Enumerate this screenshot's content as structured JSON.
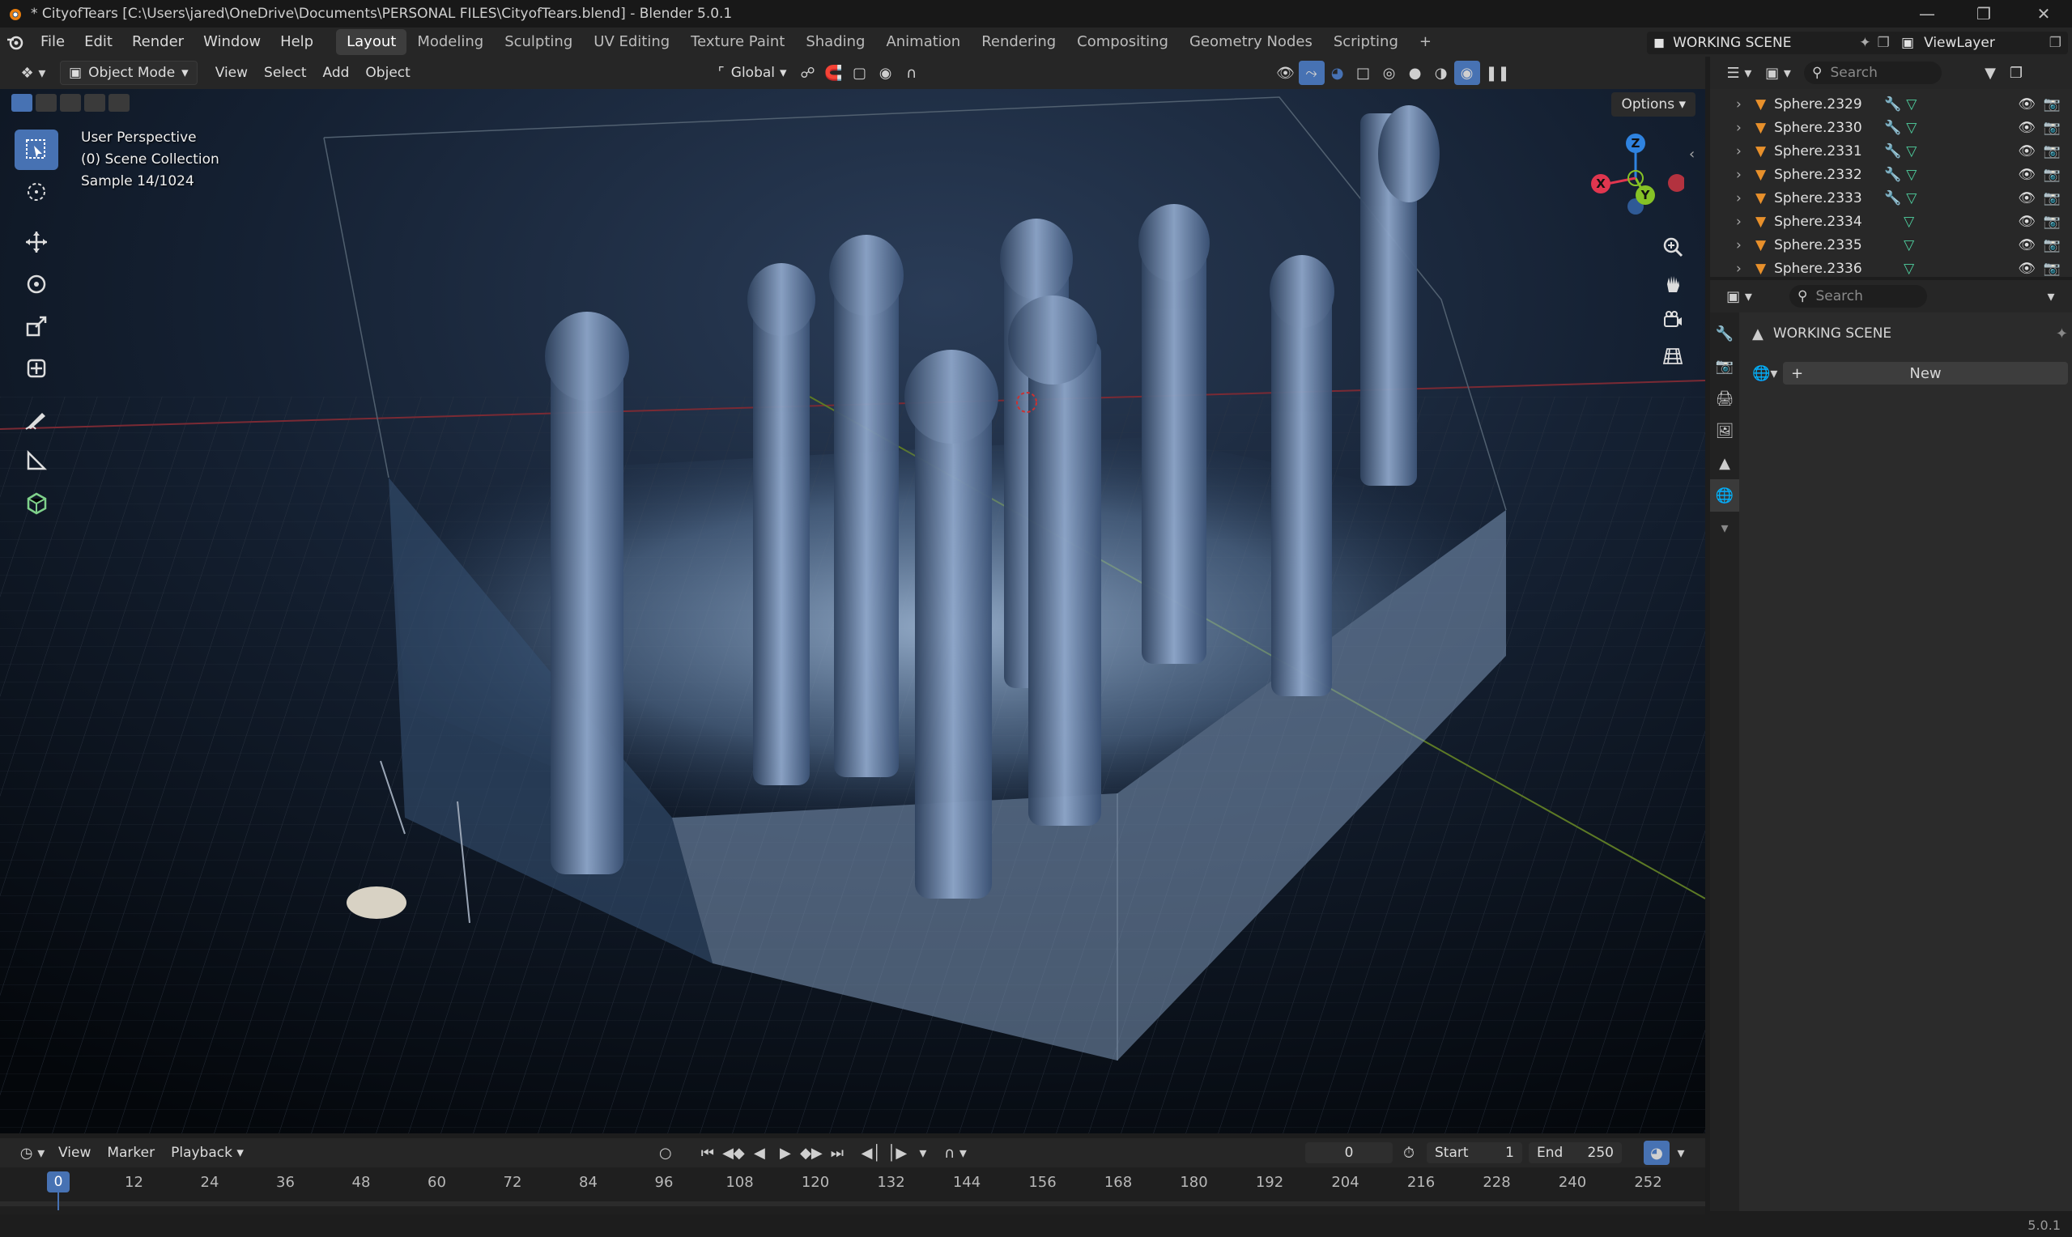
{
  "window": {
    "title": "* CityofTears [C:\\Users\\jared\\OneDrive\\Documents\\PERSONAL FILES\\CityofTears.blend] - Blender 5.0.1"
  },
  "menu": [
    "File",
    "Edit",
    "Render",
    "Window",
    "Help"
  ],
  "workspaces": [
    "Layout",
    "Modeling",
    "Sculpting",
    "UV Editing",
    "Texture Paint",
    "Shading",
    "Animation",
    "Rendering",
    "Compositing",
    "Geometry Nodes",
    "Scripting"
  ],
  "active_workspace": "Layout",
  "scene": {
    "name": "WORKING SCENE",
    "view_layer": "ViewLayer"
  },
  "viewport_header": {
    "mode": "Object Mode",
    "menus": [
      "View",
      "Select",
      "Add",
      "Object"
    ],
    "orientation": "Global",
    "options": "Options"
  },
  "viewport_info": {
    "perspective": "User Perspective",
    "collection": "(0) Scene Collection",
    "sample": "Sample 14/1024"
  },
  "gizmo": {
    "z": "Z",
    "y": "Y",
    "x": "X"
  },
  "outliner": {
    "search_placeholder": "Search",
    "rows": [
      {
        "name": "Sphere.2329",
        "has_modifier": true
      },
      {
        "name": "Sphere.2330",
        "has_modifier": true
      },
      {
        "name": "Sphere.2331",
        "has_modifier": true
      },
      {
        "name": "Sphere.2332",
        "has_modifier": true
      },
      {
        "name": "Sphere.2333",
        "has_modifier": true
      },
      {
        "name": "Sphere.2334",
        "has_modifier": false
      },
      {
        "name": "Sphere.2335",
        "has_modifier": false
      },
      {
        "name": "Sphere.2336",
        "has_modifier": false
      }
    ]
  },
  "properties": {
    "search_placeholder": "Search",
    "context_title": "WORKING SCENE",
    "new_button": "New"
  },
  "timeline": {
    "menus": [
      "View",
      "Marker",
      "Playback"
    ],
    "current_frame": "0",
    "start_label": "Start",
    "start_value": "1",
    "end_label": "End",
    "end_value": "250",
    "ruler": [
      "0",
      "12",
      "24",
      "36",
      "48",
      "60",
      "72",
      "84",
      "96",
      "108",
      "120",
      "132",
      "144",
      "156",
      "168",
      "180",
      "192",
      "204",
      "216",
      "228",
      "240",
      "252"
    ]
  },
  "statusbar": {
    "version": "5.0.1"
  },
  "colors": {
    "accent": "#4772b3",
    "x_axis": "#e0364f",
    "y_axis": "#86c226",
    "z_axis": "#2f83e0",
    "object_orange": "#e8902b",
    "modifier_blue": "#5a9ee8",
    "mesh_green": "#4fd1a0"
  }
}
